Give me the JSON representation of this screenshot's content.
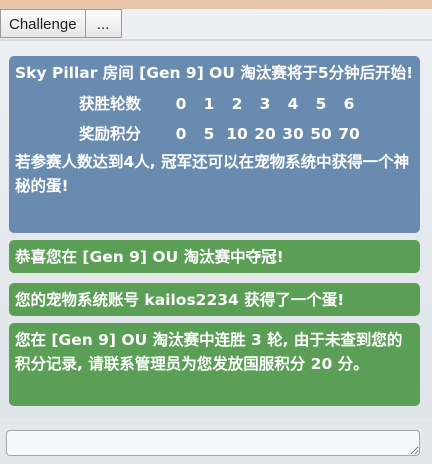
{
  "tabs": {
    "challenge": "Challenge",
    "more": "..."
  },
  "announcement": {
    "title": "Sky Pillar 房间 [Gen 9] OU 淘汰赛将于5分钟后开始!",
    "table": {
      "wins_label": "获胜轮数",
      "wins": [
        "0",
        "1",
        "2",
        "3",
        "4",
        "5",
        "6"
      ],
      "points_label": "奖励积分",
      "points": [
        "0",
        "5",
        "10",
        "20",
        "30",
        "50",
        "70"
      ]
    },
    "note": "若参赛人数达到4人, 冠军还可以在宠物系统中获得一个神秘的蛋!"
  },
  "messages": [
    {
      "text": "恭喜您在 [Gen 9] OU 淘汰赛中夺冠!"
    },
    {
      "text": "您的宠物系统账号 kailos2234 获得了一个蛋!"
    },
    {
      "text": "您在 [Gen 9] OU 淘汰赛中连胜 3 轮, 由于未查到您的积分记录, 请联系管理员为您发放国服积分 20 分。"
    }
  ],
  "chat": {
    "placeholder": ""
  },
  "colors": {
    "blue_box": "#6a8bb0",
    "green_box": "#5a9f55",
    "top_bar": "#e8c4a8"
  }
}
